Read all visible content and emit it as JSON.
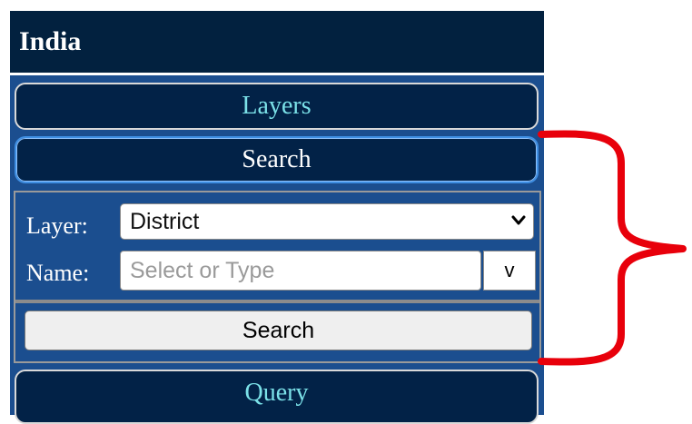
{
  "panel": {
    "title": "India"
  },
  "accordion": {
    "layers_label": "Layers",
    "search_label": "Search",
    "query_label": "Query"
  },
  "search_form": {
    "layer_label": "Layer:",
    "layer_value": "District",
    "name_label": "Name:",
    "name_placeholder": "Select or Type",
    "name_value": "",
    "dropdown_toggle_label": "v",
    "submit_label": "Search"
  },
  "colors": {
    "header_bg": "#02213f",
    "panel_bg": "#1b4e8f",
    "accordion_text_inactive": "#7be1e8",
    "annotation_bracket": "#e8000b"
  },
  "annotation": {
    "icon": "curly-brace-icon"
  }
}
